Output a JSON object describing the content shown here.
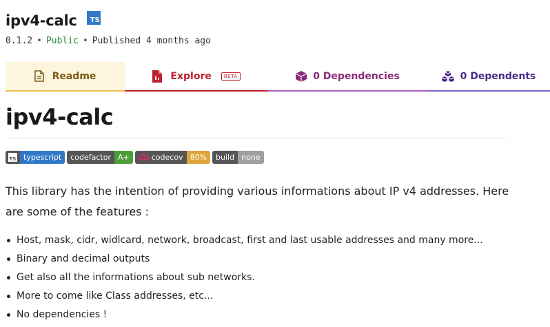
{
  "package": {
    "name": "ipv4-calc",
    "ts_badge": "TS",
    "version": "0.1.2",
    "visibility": "Public",
    "published": "Published 4 months ago"
  },
  "tabs": [
    {
      "label": "Readme",
      "icon": "document-icon"
    },
    {
      "label": "Explore",
      "icon": "file-icon",
      "tag": "BETA"
    },
    {
      "label": "0 Dependencies",
      "icon": "cube-icon"
    },
    {
      "label": "0 Dependents",
      "icon": "cubes-icon"
    }
  ],
  "readme": {
    "title": "ipv4-calc",
    "badges": [
      {
        "left": "typescript",
        "right": "",
        "color": "#3178c6",
        "has_icon": true
      },
      {
        "left": "codefactor",
        "right": "A+",
        "color": "#4c9f38"
      },
      {
        "left": "codecov",
        "right": "80%",
        "color": "#dfa53b"
      },
      {
        "left": "build",
        "right": "none",
        "color": "#9f9f9f"
      }
    ],
    "intro": "This library has the intention of providing various informations about IP v4 addresses. Here are some of the features :",
    "features": [
      "Host, mask, cidr, widlcard, network, broadcast, first and last usable addresses and many more...",
      "Binary and decimal outputs",
      "Get also all the informations about sub networks.",
      "More to come like Class addresses, etc...",
      "No dependencies !"
    ]
  },
  "colors": {
    "readme_tab": "#f0c04a",
    "explore_tab": "#c0212e",
    "deps_tab": "#b05fc0",
    "dependents_tab": "#7a5fcf"
  }
}
